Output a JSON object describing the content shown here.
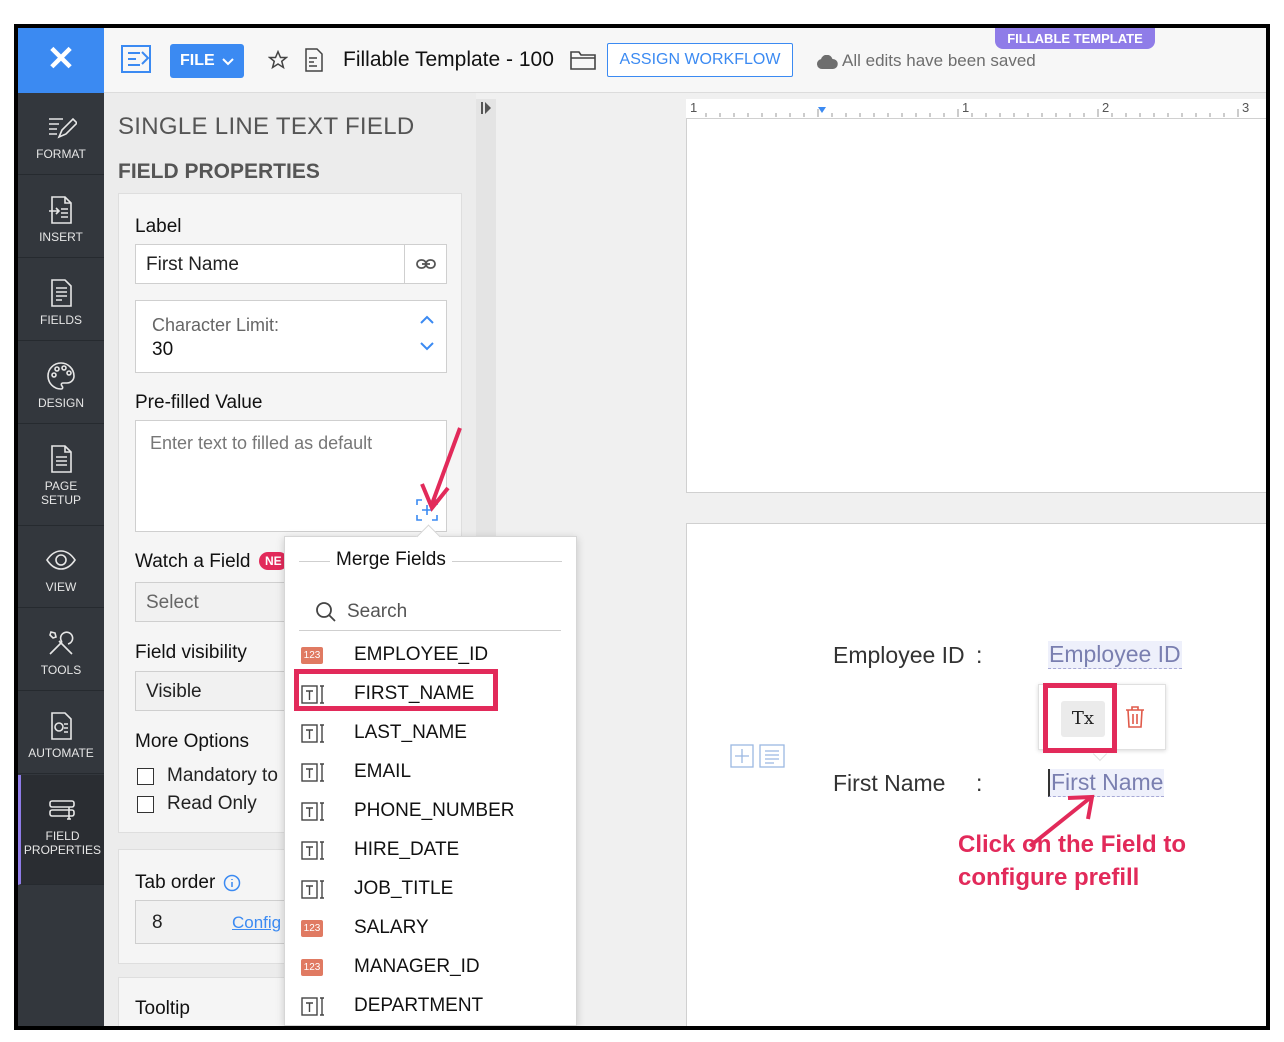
{
  "colors": {
    "accent": "#3b8af2",
    "annotation": "#e22a5a",
    "badge": "#8f7ce8",
    "rail": "#33373d"
  },
  "rail": {
    "items": [
      {
        "label": "FORMAT",
        "icon": "format-pen-icon"
      },
      {
        "label": "INSERT",
        "icon": "insert-icon"
      },
      {
        "label": "FIELDS",
        "icon": "fields-icon"
      },
      {
        "label": "DESIGN",
        "icon": "design-palette-icon"
      },
      {
        "label": "PAGE SETUP",
        "icon": "page-setup-icon"
      },
      {
        "label": "VIEW",
        "icon": "eye-icon"
      },
      {
        "label": "TOOLS",
        "icon": "tools-icon"
      },
      {
        "label": "AUTOMATE",
        "icon": "automate-icon"
      },
      {
        "label": "FIELD PROPERTIES",
        "icon": "field-properties-icon"
      }
    ]
  },
  "topbar": {
    "file_label": "FILE",
    "doc_title": "Fillable Template - 100",
    "assign_label": "ASSIGN WORKFLOW",
    "save_status": "All edits have been saved",
    "badge": "FILLABLE TEMPLATE"
  },
  "panel": {
    "title": "SINGLE LINE TEXT FIELD",
    "subtitle": "FIELD PROPERTIES",
    "label_heading": "Label",
    "label_value": "First Name",
    "char_limit_label": "Character Limit:",
    "char_limit_value": "30",
    "prefilled_heading": "Pre-filled Value",
    "prefilled_placeholder": "Enter text to filled as default",
    "watch_heading": "Watch a Field",
    "watch_badge": "NE",
    "watch_value": "Select",
    "visibility_heading": "Field visibility",
    "visibility_value": "Visible",
    "more_options_heading": "More Options",
    "mandatory_label": "Mandatory to",
    "readonly_label": "Read Only",
    "tab_order_heading": "Tab order",
    "tab_order_value": "8",
    "tab_order_link": "Config",
    "tooltip_heading": "Tooltip"
  },
  "merge": {
    "title": "Merge Fields",
    "search_placeholder": "Search",
    "fields": [
      {
        "name": "EMPLOYEE_ID",
        "type": "number",
        "type_label": "123"
      },
      {
        "name": "FIRST_NAME",
        "type": "text"
      },
      {
        "name": "LAST_NAME",
        "type": "text"
      },
      {
        "name": "EMAIL",
        "type": "text"
      },
      {
        "name": "PHONE_NUMBER",
        "type": "text"
      },
      {
        "name": "HIRE_DATE",
        "type": "text"
      },
      {
        "name": "JOB_TITLE",
        "type": "text"
      },
      {
        "name": "SALARY",
        "type": "number",
        "type_label": "123"
      },
      {
        "name": "MANAGER_ID",
        "type": "number",
        "type_label": "123"
      },
      {
        "name": "DEPARTMENT",
        "type": "text"
      }
    ]
  },
  "ruler": {
    "marks": [
      "1",
      "1",
      "2",
      "3"
    ]
  },
  "document": {
    "employee_label": "Employee ID",
    "employee_colon": ":",
    "employee_field": "Employee ID",
    "first_label": "First Name",
    "first_colon": ":",
    "first_field": "First Name"
  },
  "toolbar": {
    "clear_format_label": "Tx"
  },
  "annotation": {
    "text": "Click on the Field to configure prefill"
  }
}
